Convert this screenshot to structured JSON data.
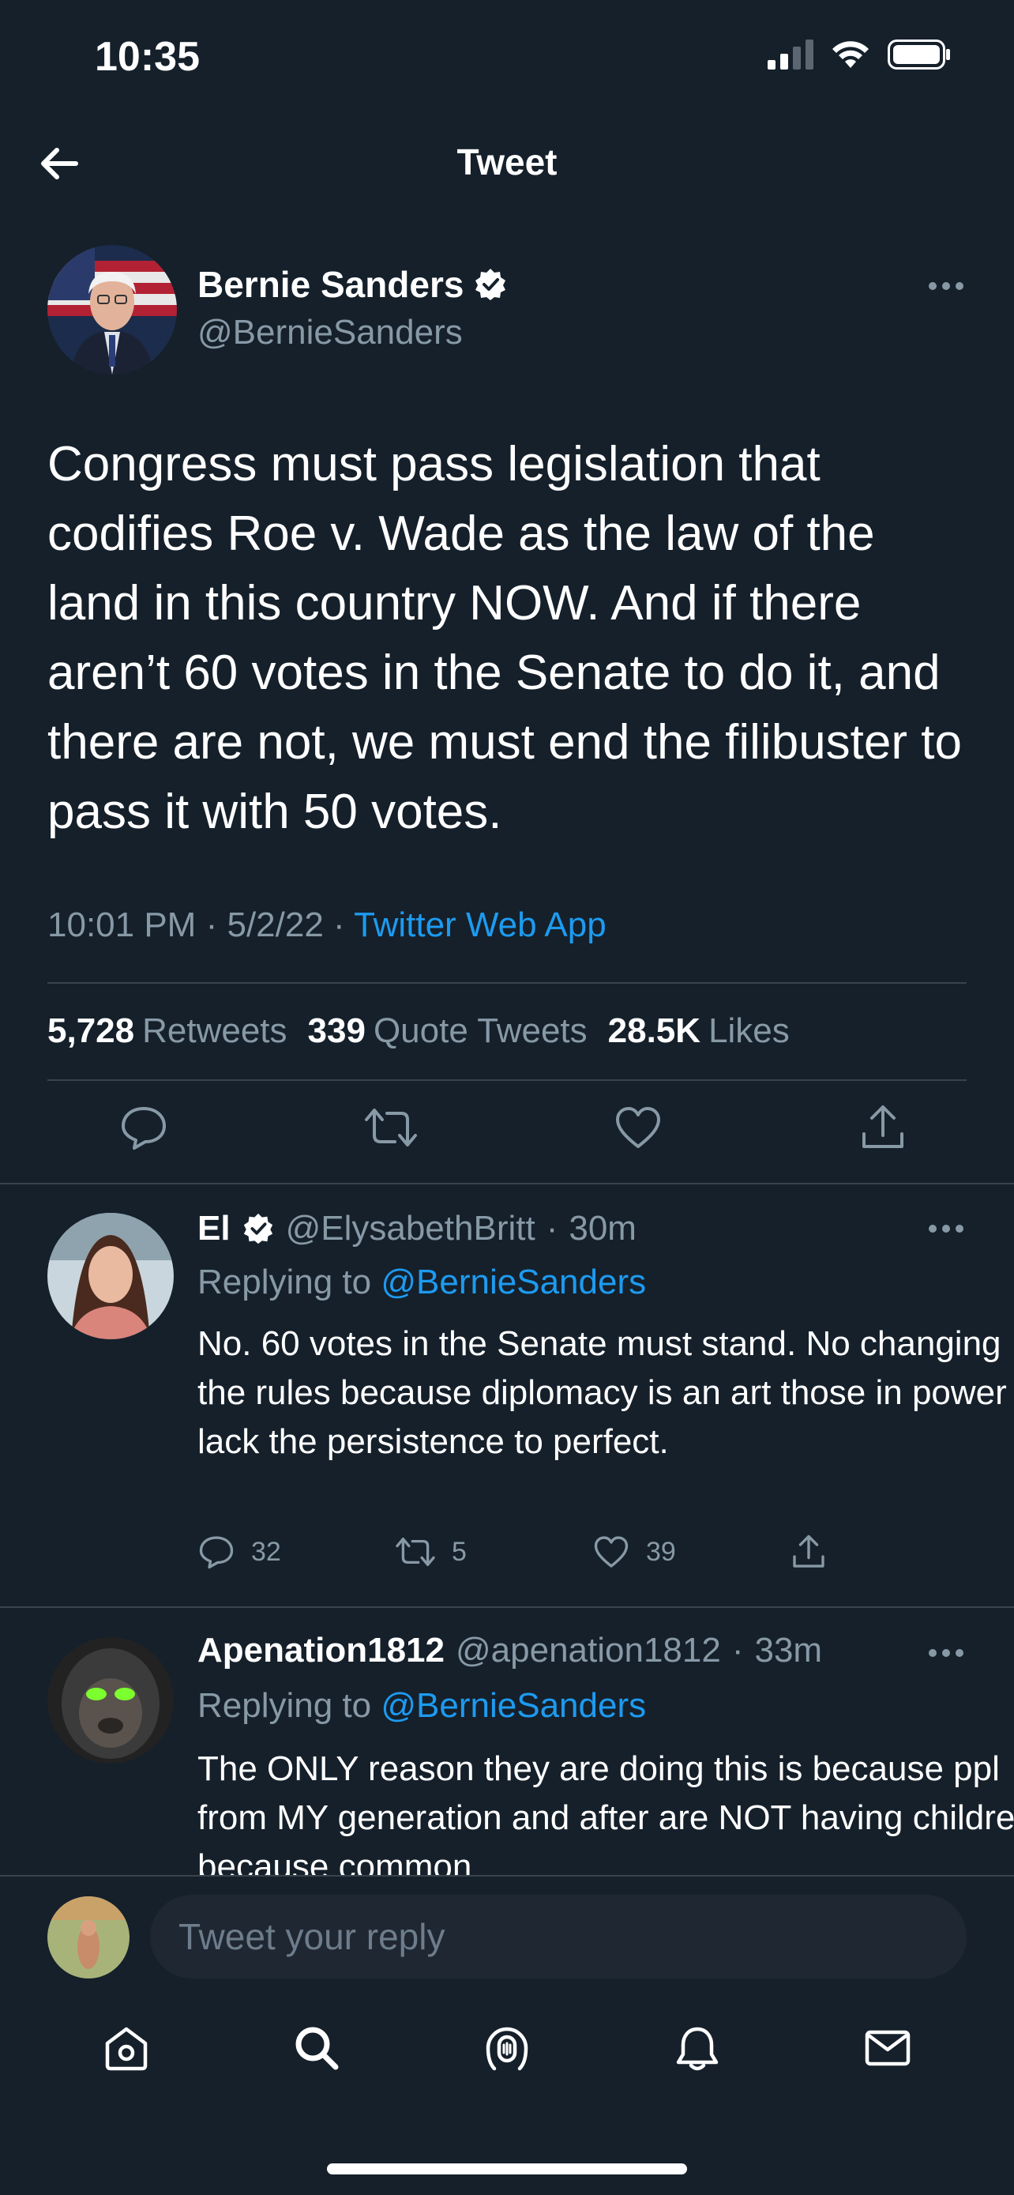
{
  "status_bar": {
    "time": "10:35"
  },
  "nav": {
    "title": "Tweet"
  },
  "main_tweet": {
    "name": "Bernie Sanders",
    "handle": "@BernieSanders",
    "text": "Congress must pass legislation that codifies Roe v. Wade as the law of the land in this country NOW. And if there aren’t 60 votes in the Senate to do it, and there are not, we must end the filibuster to pass it with 50 votes.",
    "time": "10:01 PM",
    "date": "5/2/22",
    "source": "Twitter Web App",
    "retweets_count": "5,728",
    "retweets_label": "Retweets",
    "quotes_count": "339",
    "quotes_label": "Quote Tweets",
    "likes_count": "28.5K",
    "likes_label": "Likes"
  },
  "replies": [
    {
      "name": "El",
      "handle": "@ElysabethBritt",
      "time": "30m",
      "replying_label": "Replying to",
      "replying_to": "@BernieSanders",
      "text": "No. 60 votes in the Senate must stand. No changing the rules because diplomacy is an art those in power lack the persistence to perfect.",
      "replies": "32",
      "retweets": "5",
      "likes": "39"
    },
    {
      "name": "Apenation1812",
      "handle": "@apenation1812",
      "time": "33m",
      "replying_label": "Replying to",
      "replying_to": "@BernieSanders",
      "text": "The ONLY reason they are doing this is because ppl from MY generation and after are NOT having children because common"
    }
  ],
  "composer": {
    "placeholder": "Tweet your reply"
  },
  "colors": {
    "background": "#15202b",
    "accent": "#1d9bf0",
    "muted": "#8899a6",
    "divider": "#38444d"
  }
}
